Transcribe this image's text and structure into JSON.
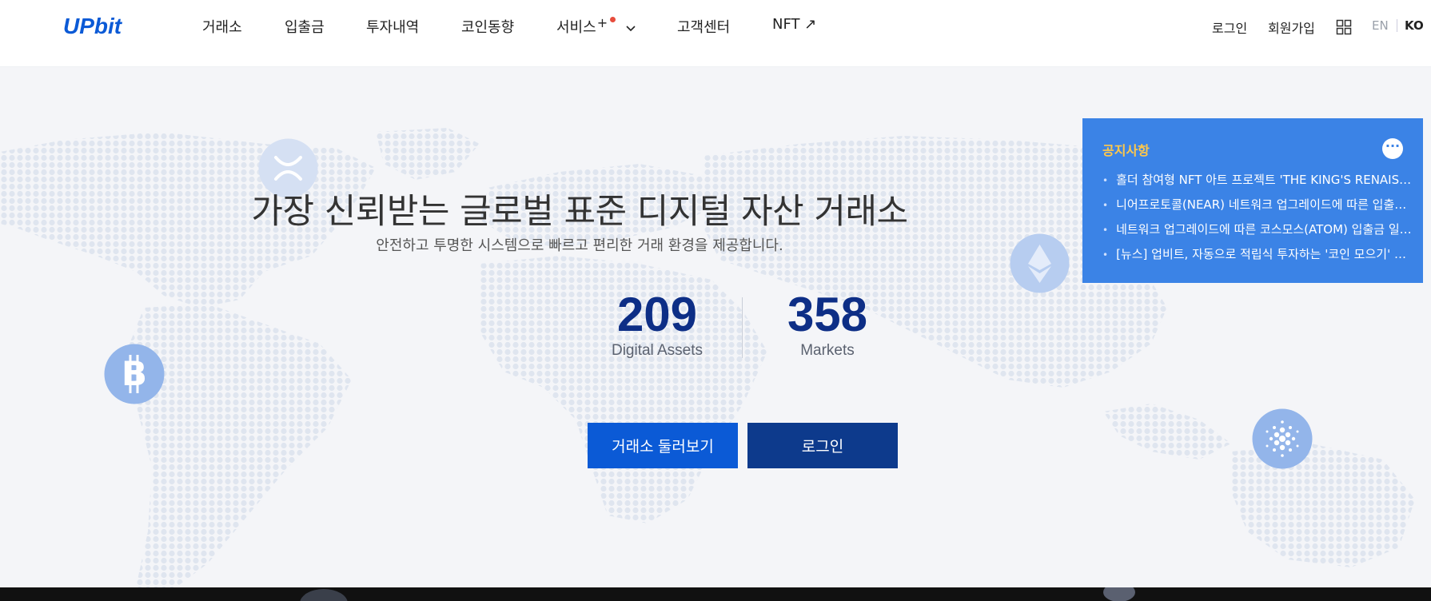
{
  "header": {
    "logo_text": "UPbit",
    "nav": [
      {
        "label": "거래소"
      },
      {
        "label": "입출금"
      },
      {
        "label": "투자내역"
      },
      {
        "label": "코인동향"
      },
      {
        "label": "서비스",
        "suffix": "+"
      },
      {
        "label": "고객센터"
      },
      {
        "label": "NFT ↗"
      }
    ],
    "login": "로그인",
    "signup": "회원가입",
    "lang_en": "EN",
    "lang_ko": "KO"
  },
  "hero": {
    "headline": "가장 신뢰받는 글로벌 표준 디지털 자산 거래소",
    "subline": "안전하고 투명한 시스템으로 빠르고 편리한 거래 환경을 제공합니다.",
    "stats": [
      {
        "value": "209",
        "label": "Digital Assets"
      },
      {
        "value": "358",
        "label": "Markets"
      }
    ],
    "btn_explore": "거래소 둘러보기",
    "btn_login": "로그인"
  },
  "notice": {
    "title": "공지사항",
    "more": "···",
    "items": [
      "홀더 참여형 NFT 아트 프로젝트 'THE KING'S RENAISSANCE'",
      "니어프로토콜(NEAR) 네트워크 업그레이드에 따른 입출금 일시 중단 안내",
      "네트워크 업그레이드에 따른 코스모스(ATOM) 입출금 일시 중단 안내",
      "[뉴스] 업비트, 자동으로 적립식 투자하는 '코인 모으기' 서비스 출시"
    ]
  },
  "colors": {
    "brand_blue": "#0b5ad6",
    "navy": "#0d3a8c",
    "stat_blue": "#0d2e86",
    "notice_bg": "#3b83e6",
    "notice_title": "#ffc84a"
  },
  "icons": [
    "chevron-down-icon",
    "grid-menu-icon",
    "xrp-coin-icon",
    "ethereum-coin-icon",
    "bitcoin-coin-icon",
    "cardano-coin-icon"
  ]
}
